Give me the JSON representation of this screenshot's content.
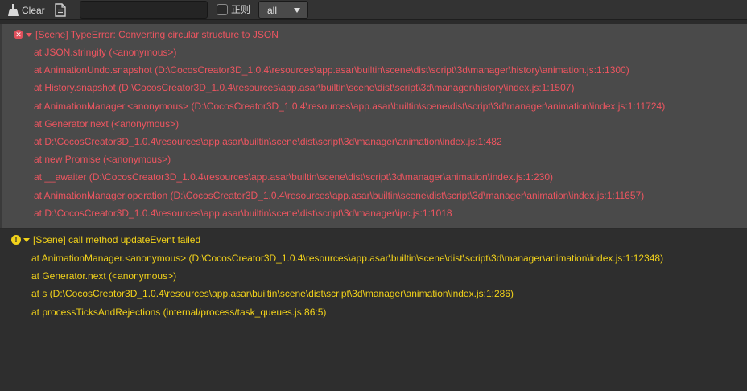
{
  "toolbar": {
    "clear_label": "Clear",
    "search": {
      "value": "",
      "placeholder": ""
    },
    "regex_label": "正则",
    "regex_checked": false,
    "level_value": "all"
  },
  "logs": {
    "error": {
      "type": "error",
      "icon": "error-circle-icon",
      "color": "#ee5560",
      "message": "[Scene] TypeError: Converting circular structure to JSON",
      "stack": [
        "at JSON.stringify (<anonymous>)",
        "at AnimationUndo.snapshot (D:\\CocosCreator3D_1.0.4\\resources\\app.asar\\builtin\\scene\\dist\\script\\3d\\manager\\history\\animation.js:1:1300)",
        "at History.snapshot (D:\\CocosCreator3D_1.0.4\\resources\\app.asar\\builtin\\scene\\dist\\script\\3d\\manager\\history\\index.js:1:1507)",
        "at AnimationManager.<anonymous> (D:\\CocosCreator3D_1.0.4\\resources\\app.asar\\builtin\\scene\\dist\\script\\3d\\manager\\animation\\index.js:1:11724)",
        "at Generator.next (<anonymous>)",
        "at D:\\CocosCreator3D_1.0.4\\resources\\app.asar\\builtin\\scene\\dist\\script\\3d\\manager\\animation\\index.js:1:482",
        "at new Promise (<anonymous>)",
        "at __awaiter (D:\\CocosCreator3D_1.0.4\\resources\\app.asar\\builtin\\scene\\dist\\script\\3d\\manager\\animation\\index.js:1:230)",
        "at AnimationManager.operation (D:\\CocosCreator3D_1.0.4\\resources\\app.asar\\builtin\\scene\\dist\\script\\3d\\manager\\animation\\index.js:1:11657)",
        "at D:\\CocosCreator3D_1.0.4\\resources\\app.asar\\builtin\\scene\\dist\\script\\3d\\manager\\ipc.js:1:1018"
      ]
    },
    "warn": {
      "type": "warning",
      "icon": "warning-circle-icon",
      "color": "#f2d21a",
      "message": "[Scene] call method updateEvent failed",
      "stack": [
        "at AnimationManager.<anonymous> (D:\\CocosCreator3D_1.0.4\\resources\\app.asar\\builtin\\scene\\dist\\script\\3d\\manager\\animation\\index.js:1:12348)",
        "at Generator.next (<anonymous>)",
        "at s (D:\\CocosCreator3D_1.0.4\\resources\\app.asar\\builtin\\scene\\dist\\script\\3d\\manager\\animation\\index.js:1:286)",
        "at processTicksAndRejections (internal/process/task_queues.js:86:5)"
      ]
    }
  }
}
